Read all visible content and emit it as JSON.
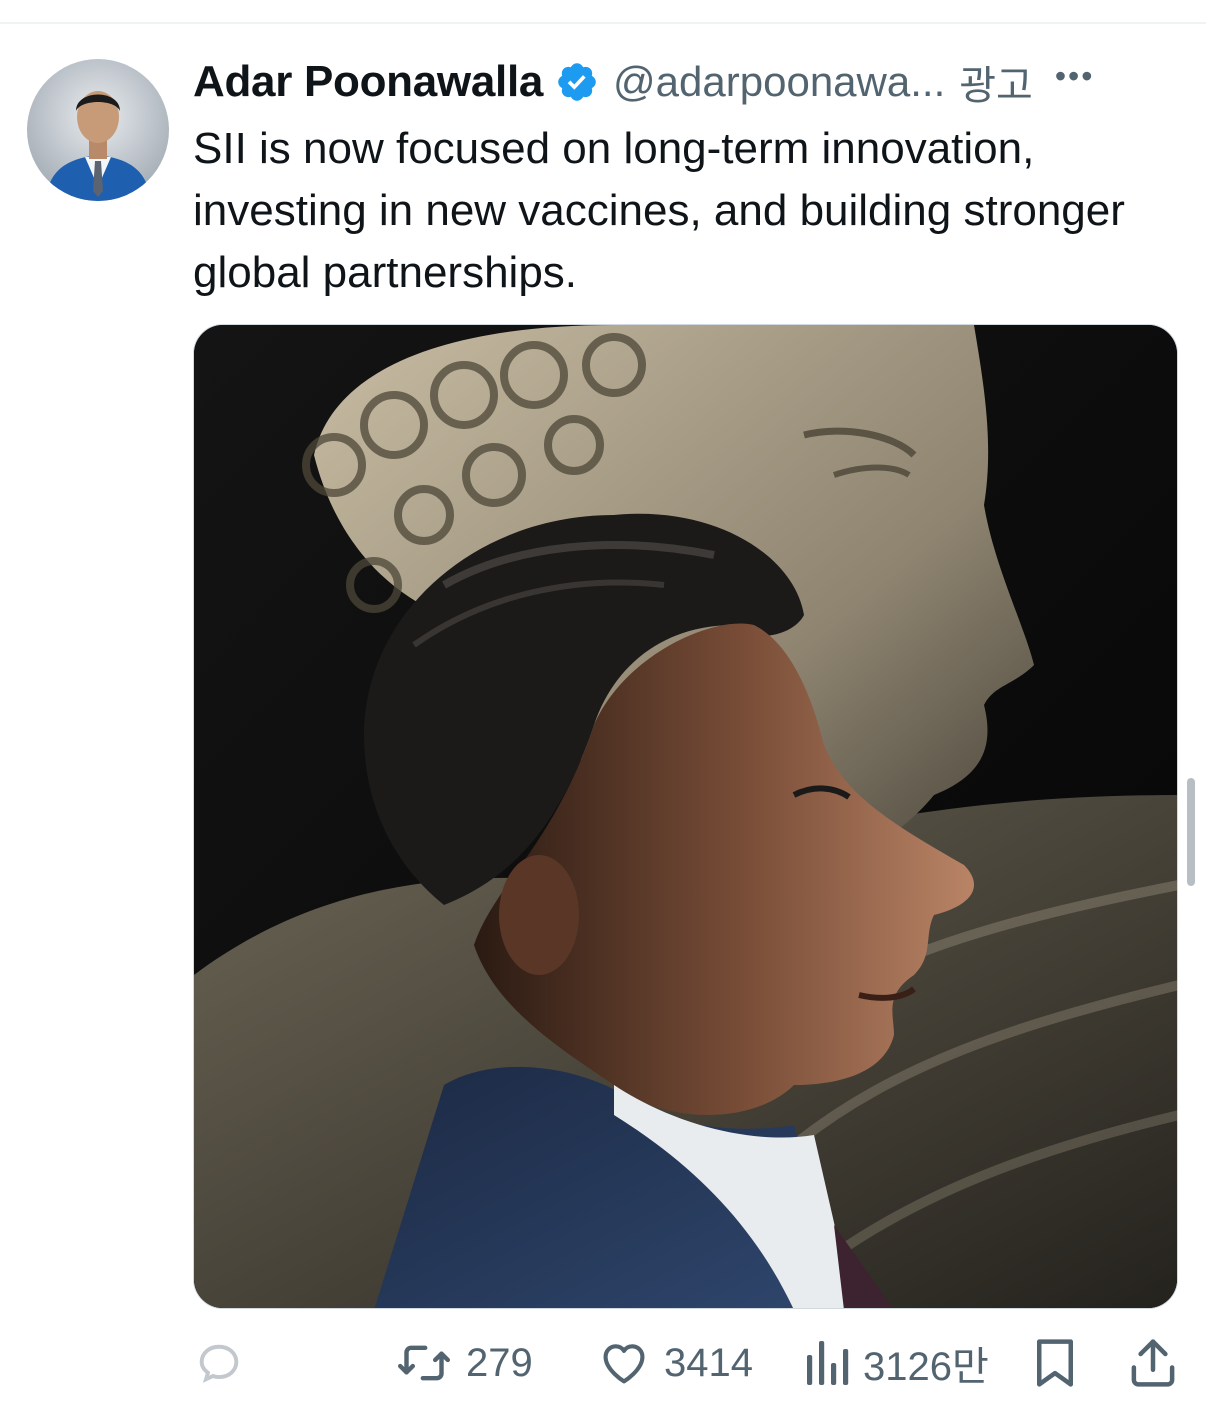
{
  "tweet": {
    "author": {
      "display_name": "Adar Poonawalla",
      "handle": "@adarpoonawa...",
      "verified": true,
      "verified_badge_color": "#1d9bf0",
      "avatar_icon": "profile-photo"
    },
    "ad_label": "광고",
    "more_icon": "more-horizontal-icon",
    "more_glyph": "•••",
    "text": "SII is now focused on long-term innovation, investing in new vaccines, and building stronger global partnerships.",
    "media": {
      "type": "photo",
      "subject": "portrait-with-statue"
    },
    "actions": {
      "reply": {
        "icon": "reply-icon",
        "count": ""
      },
      "retweet": {
        "icon": "retweet-icon",
        "count": "279"
      },
      "like": {
        "icon": "heart-icon",
        "count": "3414"
      },
      "views": {
        "icon": "views-chart-icon",
        "count": "3126만"
      },
      "bookmark": {
        "icon": "bookmark-icon"
      },
      "share": {
        "icon": "share-icon"
      }
    }
  },
  "colors": {
    "text_primary": "#0f1419",
    "text_secondary": "#536471",
    "accent": "#1d9bf0",
    "divider": "#eff3f4"
  }
}
